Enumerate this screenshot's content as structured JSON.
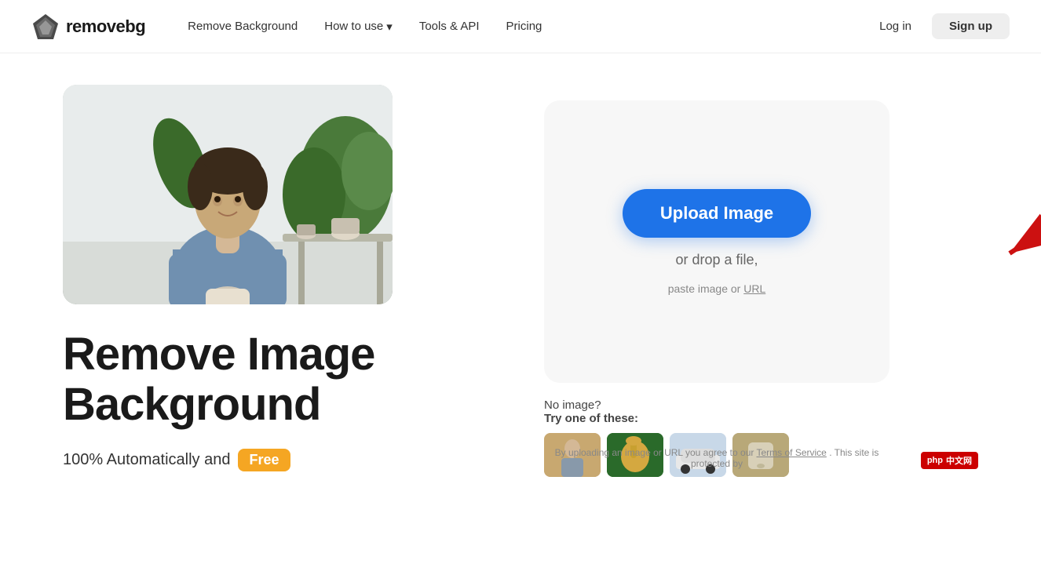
{
  "logo": {
    "icon_alt": "removebg logo diamond",
    "brand": "removebg"
  },
  "nav": {
    "links": [
      {
        "label": "Remove Background",
        "id": "remove-background",
        "has_dropdown": false
      },
      {
        "label": "How to use",
        "id": "how-to-use",
        "has_dropdown": true
      },
      {
        "label": "Tools & API",
        "id": "tools-api",
        "has_dropdown": false
      },
      {
        "label": "Pricing",
        "id": "pricing",
        "has_dropdown": false
      }
    ],
    "login_label": "Log in",
    "signup_label": "Sign up"
  },
  "hero": {
    "title_line1": "Remove Image",
    "title_line2": "Background",
    "subtitle_text": "100% Automatically and",
    "badge_label": "Free"
  },
  "upload": {
    "button_label": "Upload Image",
    "drop_text": "or drop a file,",
    "drop_sub": "paste image or",
    "drop_url": "URL"
  },
  "samples": {
    "no_image_text": "No image?",
    "try_label": "Try one of these:",
    "thumbs": [
      {
        "id": "thumb-person",
        "alt": "person sample"
      },
      {
        "id": "thumb-animal",
        "alt": "animal sample"
      },
      {
        "id": "thumb-car",
        "alt": "car sample"
      },
      {
        "id": "thumb-object",
        "alt": "object sample"
      }
    ]
  },
  "terms": {
    "text": "By uploading an image or URL you agree to our",
    "link_label": "Terms of Service",
    "after": ". This site is protected by"
  },
  "php_badge": {
    "label": "php",
    "sub": "中文网"
  }
}
